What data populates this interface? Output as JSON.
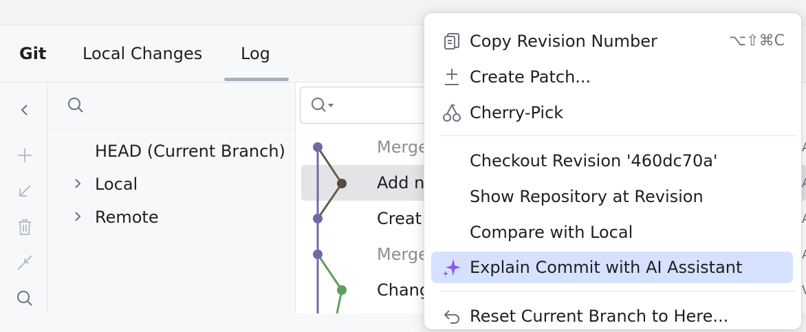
{
  "tabs": {
    "title": "Git",
    "local_changes": "Local Changes",
    "log": "Log"
  },
  "branches": {
    "head": "HEAD (Current Branch)",
    "local": "Local",
    "remote": "Remote"
  },
  "log": {
    "rows": [
      {
        "message": "Merge",
        "dim": true
      },
      {
        "message": "Add n",
        "dim": false
      },
      {
        "message": "Creat",
        "dim": false
      },
      {
        "message": "Merge",
        "dim": true
      },
      {
        "message": "Chang",
        "dim": false
      }
    ],
    "right_edge": [
      "A",
      "A",
      "A",
      "A",
      "V"
    ]
  },
  "context_menu": {
    "copy_revision": "Copy Revision Number",
    "copy_revision_shortcut": "⌥⇧⌘C",
    "create_patch": "Create Patch...",
    "cherry_pick": "Cherry-Pick",
    "checkout_revision": "Checkout Revision '460dc70a'",
    "show_repository": "Show Repository at Revision",
    "compare_local": "Compare with Local",
    "explain_commit": "Explain Commit with AI Assistant",
    "reset_branch": "Reset Current Branch to Here..."
  },
  "colors": {
    "accent_purple": "#6f6aa6",
    "branch_brown": "#6b5a4b",
    "branch_green": "#5d9e5a",
    "highlight": "#d5e1fd",
    "ai_sparkle": "#8a56f0"
  },
  "icons": {
    "back": "chevron-left-icon",
    "add": "plus-icon",
    "update": "arrow-down-left-icon",
    "delete": "trash-icon",
    "compare": "compare-arrows-icon",
    "search": "search-icon",
    "copy": "copy-icon",
    "patch": "patch-icon",
    "cherry": "cherry-icon",
    "sparkle": "sparkle-icon",
    "reset": "undo-icon"
  }
}
